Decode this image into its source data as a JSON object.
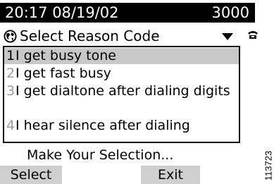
{
  "status_bar": {
    "time_date": "20:17 08/19/02",
    "extension": "3000"
  },
  "popup": {
    "title": "Select Reason Code",
    "icons": {
      "title_icon": "globe-icon",
      "dropdown": "chevron-down-icon",
      "line": "phone-icon"
    },
    "items": [
      {
        "num": "1",
        "text": "I get busy tone",
        "selected": true
      },
      {
        "num": "2",
        "text": "I get fast busy",
        "selected": false
      },
      {
        "num": "3",
        "text": "I get dialtone after dialing digits",
        "selected": false
      },
      {
        "num": "4",
        "text": "I hear silence after dialing",
        "selected": false
      }
    ]
  },
  "prompt": "Make Your Selection...",
  "softkeys": {
    "select": "Select",
    "exit": "Exit"
  },
  "figure_number": "113723",
  "colors": {
    "status_bar_bg": "#000000",
    "selected_row": "#c8c8c8",
    "softkey_bg": "#cfcfcf",
    "inactive_number": "#9c9c9c"
  }
}
